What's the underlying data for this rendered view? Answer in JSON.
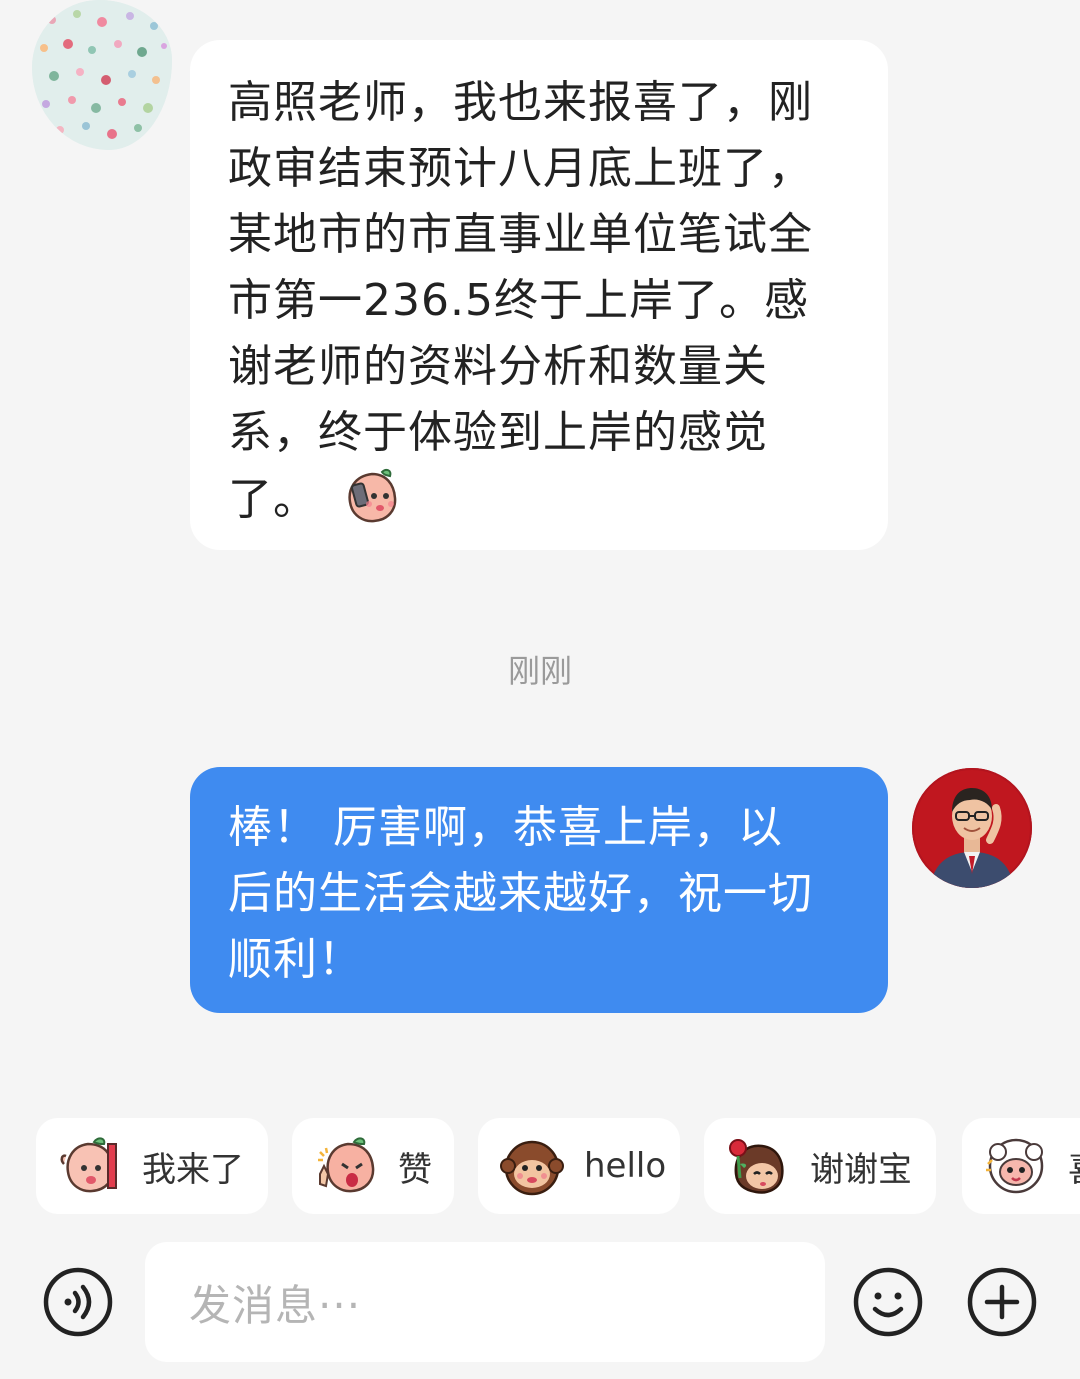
{
  "messages": [
    {
      "sender": "received",
      "text": "高照老师，我也来报喜了，刚\n政审结束预计八月底上班了，\n某地市的市直事业单位笔试全\n市第一236.5终于上岸了。感\n谢老师的资料分析和数量关\n系，终于体验到上岸的感觉\n了。",
      "sticker_icon": "peach-phone-sticker"
    },
    {
      "sender": "sent",
      "text": "棒！ 厉害啊，恭喜上岸，以\n后的生活会越来越好，祝一切\n顺利！"
    }
  ],
  "timestamp": "刚刚",
  "quick_replies": [
    {
      "label": "我来了",
      "icon": "peach-wave-sticker"
    },
    {
      "label": "赞",
      "icon": "peach-thumbs-sticker"
    },
    {
      "label": "hello",
      "icon": "monkey-sticker"
    },
    {
      "label": "谢谢宝",
      "icon": "rose-girl-sticker"
    },
    {
      "label": "喜",
      "icon": "sheep-sticker"
    }
  ],
  "input": {
    "placeholder": "发消息···"
  },
  "colors": {
    "sent_bubble": "#3f8bf0",
    "background": "#f5f5f5",
    "received_bubble": "#ffffff"
  }
}
